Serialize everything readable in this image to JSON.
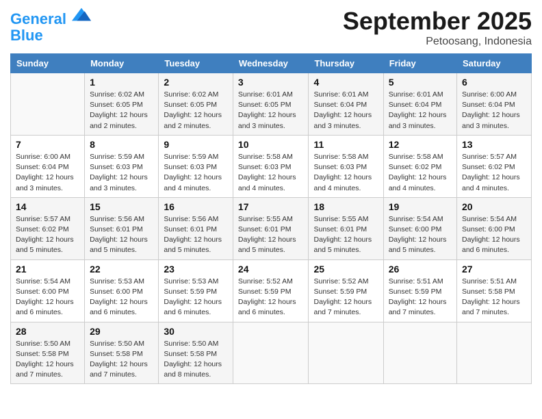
{
  "logo": {
    "line1": "General",
    "line2": "Blue"
  },
  "title": "September 2025",
  "subtitle": "Petoosang, Indonesia",
  "days_of_week": [
    "Sunday",
    "Monday",
    "Tuesday",
    "Wednesday",
    "Thursday",
    "Friday",
    "Saturday"
  ],
  "weeks": [
    [
      {
        "day": "",
        "info": ""
      },
      {
        "day": "1",
        "info": "Sunrise: 6:02 AM\nSunset: 6:05 PM\nDaylight: 12 hours\nand 2 minutes."
      },
      {
        "day": "2",
        "info": "Sunrise: 6:02 AM\nSunset: 6:05 PM\nDaylight: 12 hours\nand 2 minutes."
      },
      {
        "day": "3",
        "info": "Sunrise: 6:01 AM\nSunset: 6:05 PM\nDaylight: 12 hours\nand 3 minutes."
      },
      {
        "day": "4",
        "info": "Sunrise: 6:01 AM\nSunset: 6:04 PM\nDaylight: 12 hours\nand 3 minutes."
      },
      {
        "day": "5",
        "info": "Sunrise: 6:01 AM\nSunset: 6:04 PM\nDaylight: 12 hours\nand 3 minutes."
      },
      {
        "day": "6",
        "info": "Sunrise: 6:00 AM\nSunset: 6:04 PM\nDaylight: 12 hours\nand 3 minutes."
      }
    ],
    [
      {
        "day": "7",
        "info": "Sunrise: 6:00 AM\nSunset: 6:04 PM\nDaylight: 12 hours\nand 3 minutes."
      },
      {
        "day": "8",
        "info": "Sunrise: 5:59 AM\nSunset: 6:03 PM\nDaylight: 12 hours\nand 3 minutes."
      },
      {
        "day": "9",
        "info": "Sunrise: 5:59 AM\nSunset: 6:03 PM\nDaylight: 12 hours\nand 4 minutes."
      },
      {
        "day": "10",
        "info": "Sunrise: 5:58 AM\nSunset: 6:03 PM\nDaylight: 12 hours\nand 4 minutes."
      },
      {
        "day": "11",
        "info": "Sunrise: 5:58 AM\nSunset: 6:03 PM\nDaylight: 12 hours\nand 4 minutes."
      },
      {
        "day": "12",
        "info": "Sunrise: 5:58 AM\nSunset: 6:02 PM\nDaylight: 12 hours\nand 4 minutes."
      },
      {
        "day": "13",
        "info": "Sunrise: 5:57 AM\nSunset: 6:02 PM\nDaylight: 12 hours\nand 4 minutes."
      }
    ],
    [
      {
        "day": "14",
        "info": "Sunrise: 5:57 AM\nSunset: 6:02 PM\nDaylight: 12 hours\nand 5 minutes."
      },
      {
        "day": "15",
        "info": "Sunrise: 5:56 AM\nSunset: 6:01 PM\nDaylight: 12 hours\nand 5 minutes."
      },
      {
        "day": "16",
        "info": "Sunrise: 5:56 AM\nSunset: 6:01 PM\nDaylight: 12 hours\nand 5 minutes."
      },
      {
        "day": "17",
        "info": "Sunrise: 5:55 AM\nSunset: 6:01 PM\nDaylight: 12 hours\nand 5 minutes."
      },
      {
        "day": "18",
        "info": "Sunrise: 5:55 AM\nSunset: 6:01 PM\nDaylight: 12 hours\nand 5 minutes."
      },
      {
        "day": "19",
        "info": "Sunrise: 5:54 AM\nSunset: 6:00 PM\nDaylight: 12 hours\nand 5 minutes."
      },
      {
        "day": "20",
        "info": "Sunrise: 5:54 AM\nSunset: 6:00 PM\nDaylight: 12 hours\nand 6 minutes."
      }
    ],
    [
      {
        "day": "21",
        "info": "Sunrise: 5:54 AM\nSunset: 6:00 PM\nDaylight: 12 hours\nand 6 minutes."
      },
      {
        "day": "22",
        "info": "Sunrise: 5:53 AM\nSunset: 6:00 PM\nDaylight: 12 hours\nand 6 minutes."
      },
      {
        "day": "23",
        "info": "Sunrise: 5:53 AM\nSunset: 5:59 PM\nDaylight: 12 hours\nand 6 minutes."
      },
      {
        "day": "24",
        "info": "Sunrise: 5:52 AM\nSunset: 5:59 PM\nDaylight: 12 hours\nand 6 minutes."
      },
      {
        "day": "25",
        "info": "Sunrise: 5:52 AM\nSunset: 5:59 PM\nDaylight: 12 hours\nand 7 minutes."
      },
      {
        "day": "26",
        "info": "Sunrise: 5:51 AM\nSunset: 5:59 PM\nDaylight: 12 hours\nand 7 minutes."
      },
      {
        "day": "27",
        "info": "Sunrise: 5:51 AM\nSunset: 5:58 PM\nDaylight: 12 hours\nand 7 minutes."
      }
    ],
    [
      {
        "day": "28",
        "info": "Sunrise: 5:50 AM\nSunset: 5:58 PM\nDaylight: 12 hours\nand 7 minutes."
      },
      {
        "day": "29",
        "info": "Sunrise: 5:50 AM\nSunset: 5:58 PM\nDaylight: 12 hours\nand 7 minutes."
      },
      {
        "day": "30",
        "info": "Sunrise: 5:50 AM\nSunset: 5:58 PM\nDaylight: 12 hours\nand 8 minutes."
      },
      {
        "day": "",
        "info": ""
      },
      {
        "day": "",
        "info": ""
      },
      {
        "day": "",
        "info": ""
      },
      {
        "day": "",
        "info": ""
      }
    ]
  ]
}
